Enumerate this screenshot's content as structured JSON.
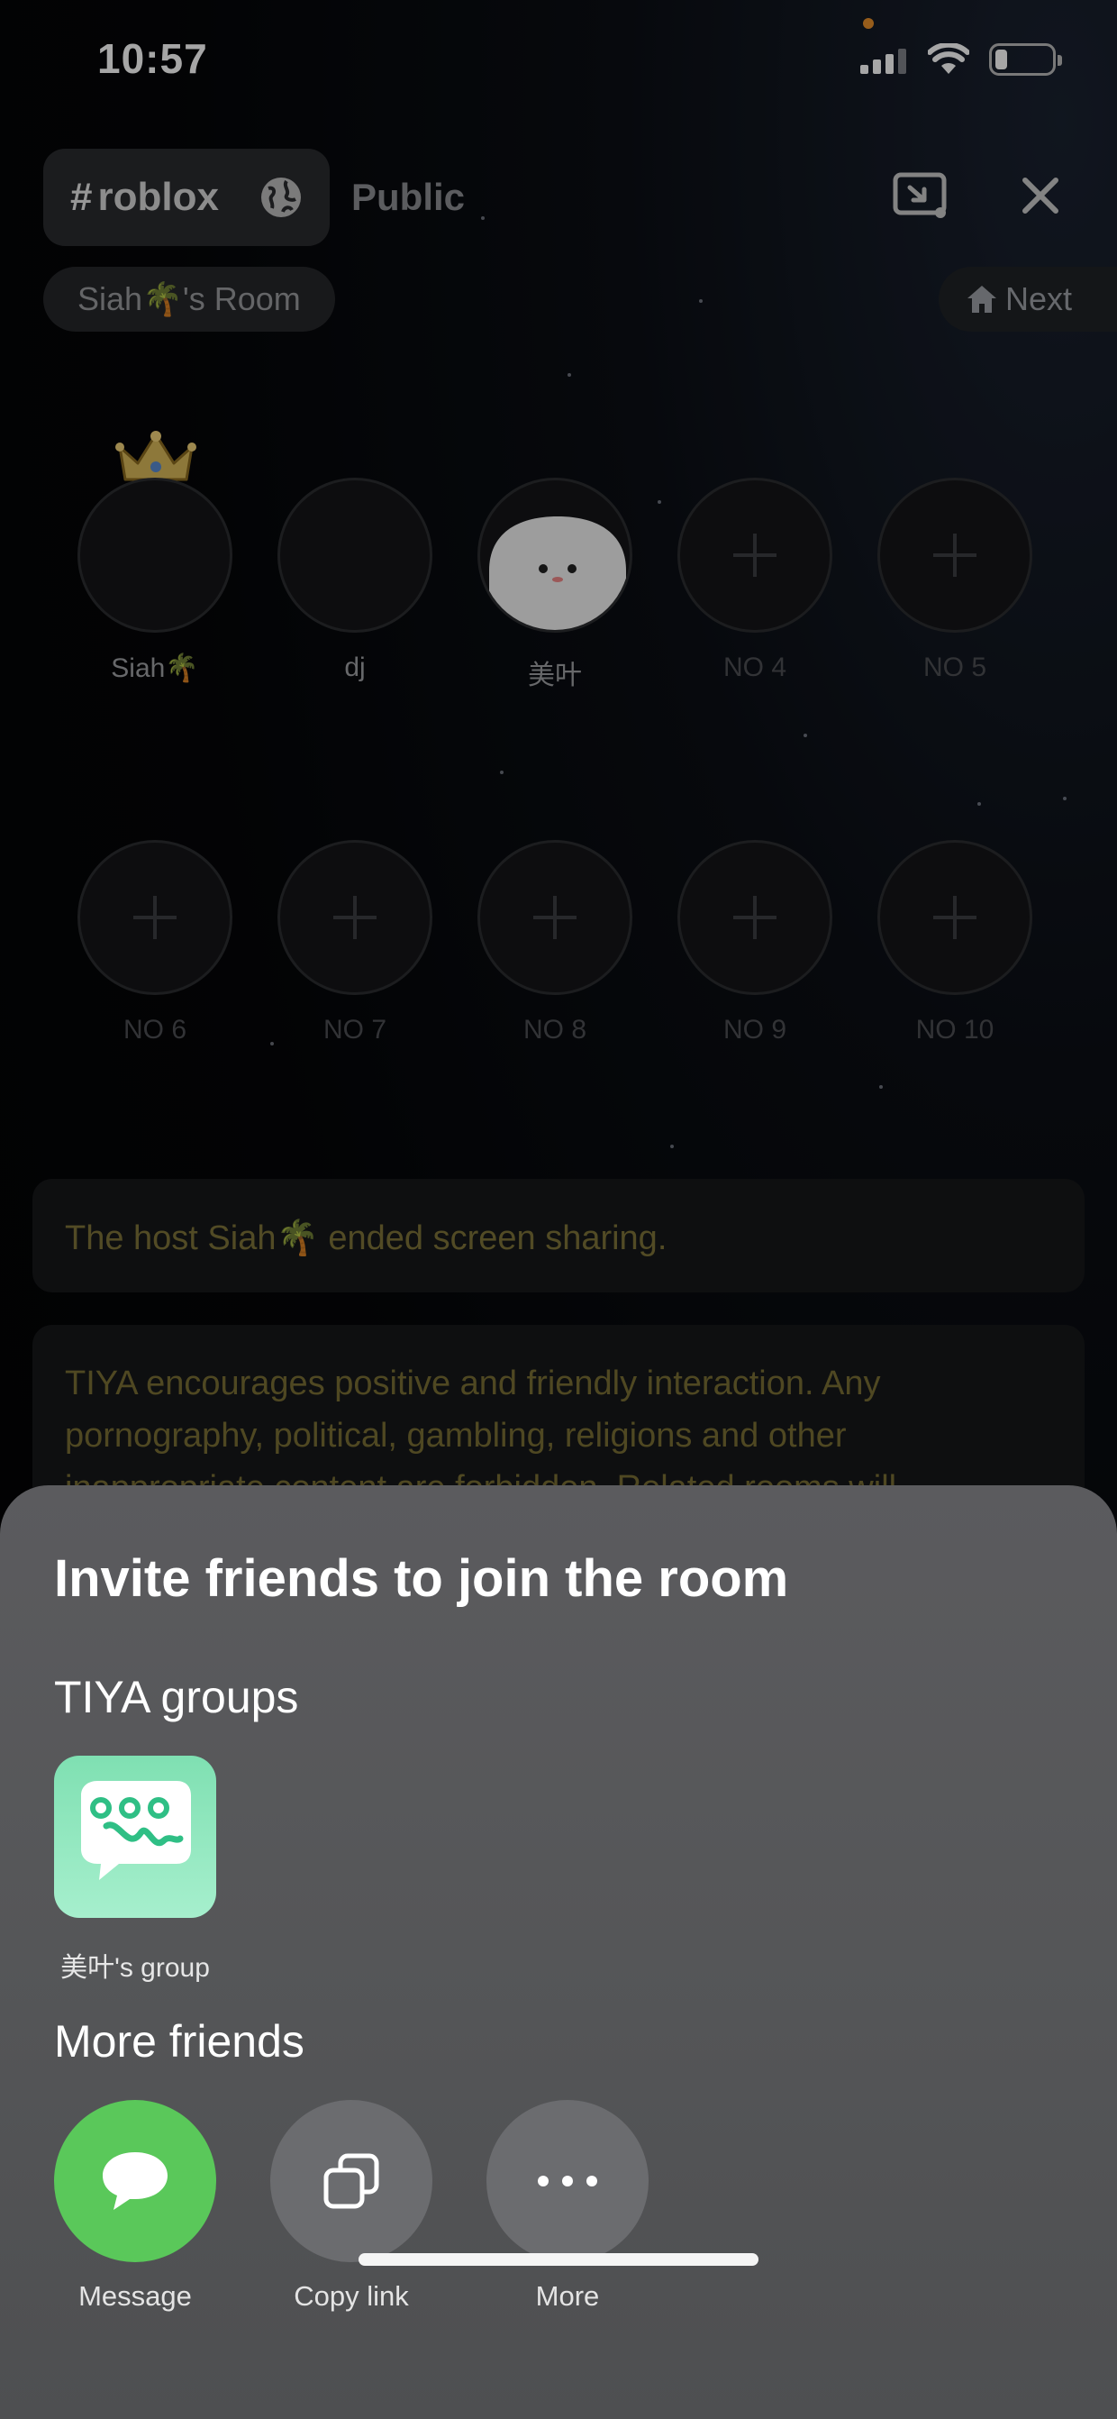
{
  "status_bar": {
    "time": "10:57"
  },
  "header": {
    "tag_symbol": "#",
    "tag": "roblox",
    "visibility": "Public",
    "room_name": "Siah🌴's Room",
    "next_label": "Next"
  },
  "seats": [
    {
      "label": "Siah🌴",
      "occupied": true,
      "host": true
    },
    {
      "label": "dj",
      "occupied": true
    },
    {
      "label": "美叶",
      "occupied": true
    },
    {
      "label": "NO 4",
      "occupied": false
    },
    {
      "label": "NO 5",
      "occupied": false
    },
    {
      "label": "NO 6",
      "occupied": false
    },
    {
      "label": "NO 7",
      "occupied": false
    },
    {
      "label": "NO 8",
      "occupied": false
    },
    {
      "label": "NO 9",
      "occupied": false
    },
    {
      "label": "NO 10",
      "occupied": false
    }
  ],
  "messages": {
    "screen_share": "The host Siah🌴 ended screen sharing.",
    "notice": "TIYA encourages positive and friendly interaction. Any pornography, political, gambling, religions and other inappropriate content are forbidden. Related rooms will"
  },
  "invite_sheet": {
    "title": "Invite friends to join the room",
    "groups_title": "TIYA groups",
    "groups": [
      {
        "label": "美叶's group"
      }
    ],
    "friends_title": "More friends",
    "actions": [
      {
        "label": "Message",
        "icon": "chat-bubble-icon",
        "color": "#5ac85a"
      },
      {
        "label": "Copy link",
        "icon": "copy-icon"
      },
      {
        "label": "More",
        "icon": "more-dots-icon"
      }
    ]
  }
}
